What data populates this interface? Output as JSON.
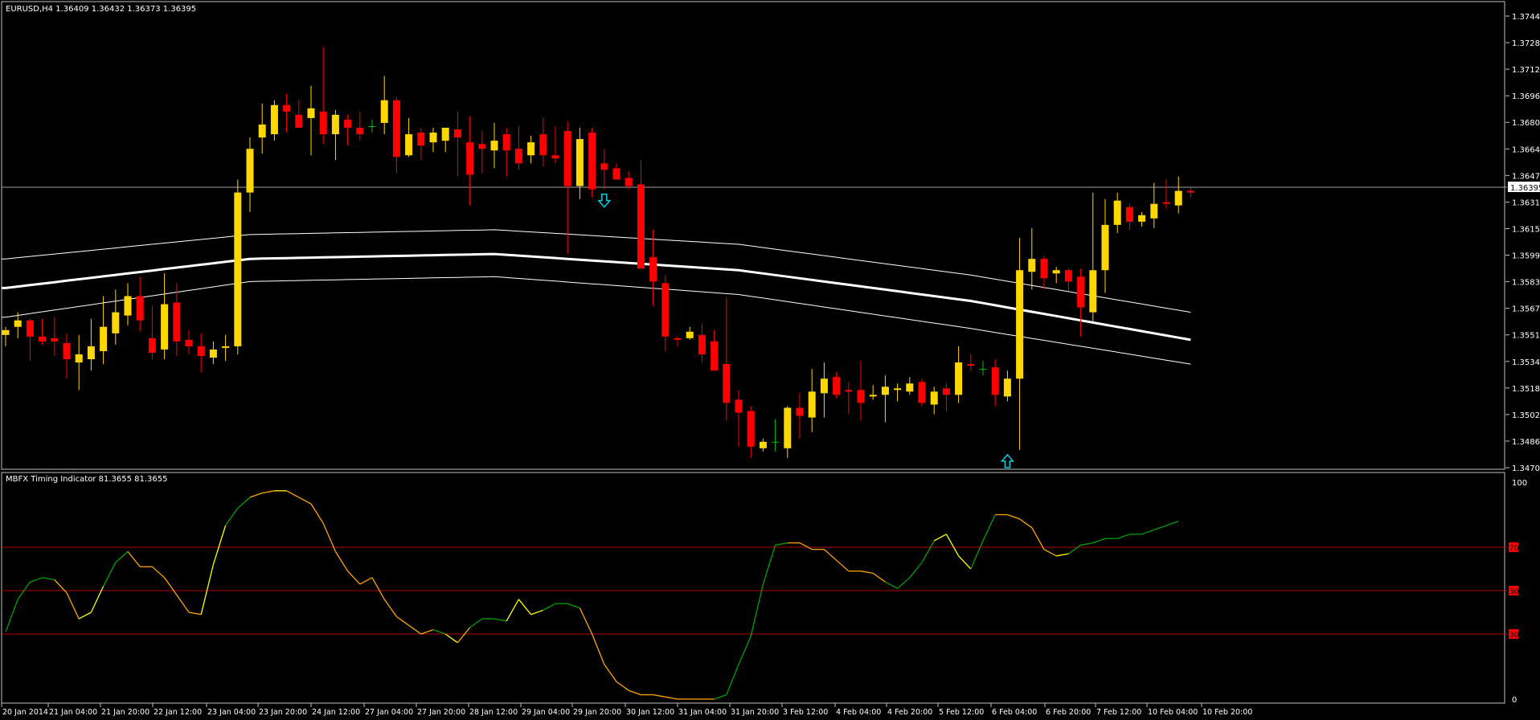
{
  "colors": {
    "background": "#000000",
    "frame": "#c0c0c0",
    "bull": "#ffd700",
    "bear": "#ff0000",
    "doji": "#00c000",
    "band": "#ffffff",
    "arrow": "#00d0e0",
    "level_line": "#b00000",
    "level_label_bg": "#ff0000",
    "timing_green": "#00a000",
    "timing_yellow": "#ffff00",
    "timing_orange": "#ffa500"
  },
  "chart_data": [
    {
      "type": "candlestick",
      "title": "EURUSD,H4  1.36409 1.36432 1.36373 1.36395",
      "ylim": [
        1.347,
        1.3749
      ],
      "y_ticks": [
        "1.37445",
        "1.37285",
        "1.37120",
        "1.36960",
        "1.36800",
        "1.36640",
        "1.36475",
        "1.36315",
        "1.36155",
        "1.35995",
        "1.35830",
        "1.35670",
        "1.35510",
        "1.35345",
        "1.35185",
        "1.35025",
        "1.34865",
        "1.34700"
      ],
      "current_price": "1.36395",
      "x_ticks": [
        "20 Jan 2014",
        "21 Jan 04:00",
        "21 Jan 20:00",
        "22 Jan 12:00",
        "23 Jan 04:00",
        "23 Jan 20:00",
        "24 Jan 12:00",
        "27 Jan 04:00",
        "27 Jan 20:00",
        "28 Jan 12:00",
        "29 Jan 04:00",
        "29 Jan 20:00",
        "30 Jan 12:00",
        "31 Jan 04:00",
        "31 Jan 20:00",
        "3 Feb 12:00",
        "4 Feb 04:00",
        "4 Feb 20:00",
        "5 Feb 12:00",
        "6 Feb 04:00",
        "6 Feb 20:00",
        "7 Feb 12:00",
        "10 Feb 04:00",
        "10 Feb 20:00"
      ],
      "ohlc": [
        [
          1.3552,
          1.3557,
          1.3545,
          1.3555
        ],
        [
          1.3557,
          1.3566,
          1.355,
          1.3561
        ],
        [
          1.3561,
          1.3562,
          1.3536,
          1.3551
        ],
        [
          1.3551,
          1.3562,
          1.3546,
          1.3548
        ],
        [
          1.355,
          1.3563,
          1.3539,
          1.3548
        ],
        [
          1.3547,
          1.3553,
          1.3525,
          1.3537
        ],
        [
          1.3535,
          1.3552,
          1.3518,
          1.354
        ],
        [
          1.3537,
          1.3562,
          1.353,
          1.3545
        ],
        [
          1.3542,
          1.3576,
          1.3534,
          1.3557
        ],
        [
          1.3553,
          1.358,
          1.3546,
          1.3566
        ],
        [
          1.3564,
          1.3584,
          1.3558,
          1.3576
        ],
        [
          1.3576,
          1.3588,
          1.3554,
          1.3561
        ],
        [
          1.355,
          1.357,
          1.3537,
          1.3541
        ],
        [
          1.3543,
          1.359,
          1.3537,
          1.3571
        ],
        [
          1.3572,
          1.3584,
          1.3539,
          1.3548
        ],
        [
          1.3549,
          1.3555,
          1.354,
          1.3545
        ],
        [
          1.3545,
          1.3553,
          1.3529,
          1.3539
        ],
        [
          1.3538,
          1.3548,
          1.3534,
          1.3543
        ],
        [
          1.3544,
          1.3552,
          1.3536,
          1.3545
        ],
        [
          1.3545,
          1.3648,
          1.354,
          1.364
        ],
        [
          1.364,
          1.3674,
          1.3628,
          1.3667
        ],
        [
          1.3674,
          1.3695,
          1.3664,
          1.3682
        ],
        [
          1.3676,
          1.3697,
          1.3672,
          1.3694
        ],
        [
          1.3694,
          1.3701,
          1.3677,
          1.369
        ],
        [
          1.3688,
          1.3697,
          1.368,
          1.368
        ],
        [
          1.3686,
          1.3706,
          1.3663,
          1.3692
        ],
        [
          1.369,
          1.373,
          1.367,
          1.3676
        ],
        [
          1.3676,
          1.3691,
          1.366,
          1.3688
        ],
        [
          1.3685,
          1.3688,
          1.3669,
          1.368
        ],
        [
          1.368,
          1.369,
          1.3672,
          1.3676
        ],
        [
          1.3681,
          1.3685,
          1.3677,
          1.3681
        ],
        [
          1.3683,
          1.3712,
          1.3676,
          1.3697
        ],
        [
          1.3697,
          1.3699,
          1.3652,
          1.3662
        ],
        [
          1.3663,
          1.3686,
          1.3662,
          1.3676
        ],
        [
          1.3677,
          1.368,
          1.366,
          1.3669
        ],
        [
          1.3671,
          1.368,
          1.3665,
          1.3677
        ],
        [
          1.3672,
          1.3679,
          1.3665,
          1.368
        ],
        [
          1.3679,
          1.369,
          1.365,
          1.3674
        ],
        [
          1.3671,
          1.3687,
          1.3632,
          1.3651
        ],
        [
          1.367,
          1.3678,
          1.3652,
          1.3667
        ],
        [
          1.3666,
          1.3683,
          1.3655,
          1.3672
        ],
        [
          1.3676,
          1.368,
          1.365,
          1.3666
        ],
        [
          1.3667,
          1.3681,
          1.3654,
          1.3658
        ],
        [
          1.3663,
          1.3675,
          1.3658,
          1.3671
        ],
        [
          1.3676,
          1.3686,
          1.3656,
          1.3663
        ],
        [
          1.3663,
          1.3681,
          1.3658,
          1.3661
        ],
        [
          1.3678,
          1.3684,
          1.3602,
          1.3644
        ],
        [
          1.3644,
          1.368,
          1.3636,
          1.3673
        ],
        [
          1.3677,
          1.368,
          1.3637,
          1.3642
        ],
        [
          1.3658,
          1.3667,
          1.3642,
          1.3654
        ],
        [
          1.3655,
          1.3658,
          1.3648,
          1.3648
        ],
        [
          1.3649,
          1.3653,
          1.3642,
          1.3644
        ],
        [
          1.3645,
          1.366,
          1.3615,
          1.3593
        ],
        [
          1.36,
          1.3617,
          1.357,
          1.3585
        ],
        [
          1.3584,
          1.3589,
          1.3542,
          1.3551
        ],
        [
          1.355,
          1.3551,
          1.3545,
          1.3549
        ],
        [
          1.355,
          1.3557,
          1.3549,
          1.3554
        ],
        [
          1.3552,
          1.3559,
          1.3535,
          1.354
        ],
        [
          1.3548,
          1.3555,
          1.353,
          1.353
        ],
        [
          1.3534,
          1.3575,
          1.3499,
          1.351
        ],
        [
          1.3512,
          1.3518,
          1.3483,
          1.3504
        ],
        [
          1.3505,
          1.3508,
          1.3476,
          1.3483
        ],
        [
          1.3482,
          1.3488,
          1.348,
          1.3486
        ],
        [
          1.3486,
          1.35,
          1.348,
          1.3486
        ],
        [
          1.3482,
          1.3508,
          1.3476,
          1.3507
        ],
        [
          1.3507,
          1.3516,
          1.3488,
          1.3502
        ],
        [
          1.3501,
          1.3531,
          1.3492,
          1.3517
        ],
        [
          1.3516,
          1.3535,
          1.3501,
          1.3525
        ],
        [
          1.3526,
          1.3529,
          1.3513,
          1.3515
        ],
        [
          1.3518,
          1.3523,
          1.3503,
          1.3517
        ],
        [
          1.3518,
          1.3536,
          1.3499,
          1.351
        ],
        [
          1.3514,
          1.3521,
          1.3512,
          1.3515
        ],
        [
          1.3515,
          1.3527,
          1.3498,
          1.352
        ],
        [
          1.3518,
          1.3522,
          1.3511,
          1.3519
        ],
        [
          1.3517,
          1.3526,
          1.3515,
          1.3522
        ],
        [
          1.3523,
          1.3525,
          1.3508,
          1.351
        ],
        [
          1.3509,
          1.352,
          1.3503,
          1.3517
        ],
        [
          1.3519,
          1.3522,
          1.3505,
          1.3515
        ],
        [
          1.3515,
          1.3545,
          1.351,
          1.3535
        ],
        [
          1.3534,
          1.354,
          1.353,
          1.3533
        ],
        [
          1.3531,
          1.3536,
          1.3527,
          1.3531
        ],
        [
          1.3532,
          1.3537,
          1.3508,
          1.3515
        ],
        [
          1.3514,
          1.353,
          1.3511,
          1.3525
        ],
        [
          1.3525,
          1.3612,
          1.3481,
          1.3592
        ],
        [
          1.3591,
          1.3618,
          1.358,
          1.3599
        ],
        [
          1.3599,
          1.3601,
          1.358,
          1.3587
        ],
        [
          1.359,
          1.3594,
          1.3584,
          1.3592
        ],
        [
          1.3592,
          1.3593,
          1.3579,
          1.3585
        ],
        [
          1.3588,
          1.3593,
          1.3551,
          1.3569
        ],
        [
          1.3566,
          1.364,
          1.356,
          1.3592
        ],
        [
          1.3592,
          1.3636,
          1.3578,
          1.362
        ],
        [
          1.362,
          1.364,
          1.3615,
          1.3635
        ],
        [
          1.3631,
          1.3633,
          1.3617,
          1.3622
        ],
        [
          1.3622,
          1.3628,
          1.3619,
          1.3626
        ],
        [
          1.3624,
          1.3646,
          1.3618,
          1.3633
        ],
        [
          1.3634,
          1.3648,
          1.363,
          1.3633
        ],
        [
          1.3632,
          1.365,
          1.3627,
          1.3641
        ],
        [
          1.3641,
          1.3643,
          1.3637,
          1.364
        ]
      ],
      "band_center": {
        "x": [
          0,
          20,
          40,
          60,
          79,
          97
        ],
        "y": [
          1.3581,
          1.3599,
          1.3602,
          1.3592,
          1.3573,
          1.3549
        ]
      },
      "band_upper": {
        "x": [
          0,
          20,
          40,
          60,
          79,
          97
        ],
        "y": [
          1.3599,
          1.3614,
          1.3617,
          1.3608,
          1.3589,
          1.3566
        ]
      },
      "band_lower": {
        "x": [
          0,
          20,
          40,
          60,
          79,
          97
        ],
        "y": [
          1.3563,
          1.3585,
          1.3588,
          1.3577,
          1.3556,
          1.3534
        ]
      },
      "arrows": [
        {
          "dir": "down",
          "index": 49,
          "price": 1.3634
        },
        {
          "dir": "up",
          "index": 82,
          "price": 1.3475
        }
      ]
    },
    {
      "type": "line",
      "title": "MBFX Timing Indicator 81.3655 81.3655",
      "ylim": [
        0,
        100
      ],
      "y_ticks": [
        "100",
        "0"
      ],
      "levels": [
        {
          "value": 70,
          "label": "70"
        },
        {
          "value": 50,
          "label": "50"
        },
        {
          "value": 30,
          "label": "30"
        }
      ],
      "values": [
        31,
        46,
        54,
        56,
        55,
        49,
        37,
        40,
        52,
        63,
        68,
        61,
        61,
        56,
        48,
        40,
        39,
        62,
        80,
        88,
        93,
        95,
        96,
        96,
        93,
        90,
        81,
        68,
        59,
        53,
        56,
        46,
        38,
        34,
        30,
        32,
        30,
        26,
        33,
        37,
        37,
        36,
        46,
        39,
        41,
        44,
        44,
        42,
        30,
        16,
        8,
        4,
        2,
        2,
        1,
        0,
        0,
        0,
        0,
        2,
        16,
        29,
        53,
        71,
        72,
        72,
        69,
        69,
        64,
        59,
        59,
        58,
        54,
        51,
        56,
        63,
        73,
        76,
        66,
        60,
        73,
        85,
        85,
        83,
        79,
        69,
        66,
        67,
        71,
        72,
        74,
        74,
        76,
        76,
        78,
        80,
        82
      ],
      "colors": [
        "g",
        "g",
        "g",
        "g",
        "o",
        "o",
        "y",
        "y",
        "g",
        "g",
        "o",
        "o",
        "o",
        "o",
        "o",
        "o",
        "y",
        "y",
        "g",
        "g",
        "o",
        "o",
        "y",
        "o",
        "o",
        "o",
        "o",
        "o",
        "o",
        "o",
        "o",
        "o",
        "o",
        "o",
        "o",
        "g",
        "y",
        "o",
        "g",
        "g",
        "g",
        "y",
        "y",
        "y",
        "g",
        "g",
        "g",
        "o",
        "o",
        "o",
        "o",
        "o",
        "o",
        "o",
        "o",
        "o",
        "o",
        "o",
        "g",
        "g",
        "g",
        "g",
        "g",
        "g",
        "o",
        "o",
        "o",
        "o",
        "o",
        "o",
        "o",
        "o",
        "g",
        "g",
        "g",
        "g",
        "y",
        "y",
        "y",
        "g",
        "g",
        "o",
        "o",
        "o",
        "o",
        "o",
        "y",
        "g",
        "g",
        "g",
        "g",
        "g",
        "g",
        "g",
        "g",
        "g",
        "g"
      ]
    }
  ]
}
